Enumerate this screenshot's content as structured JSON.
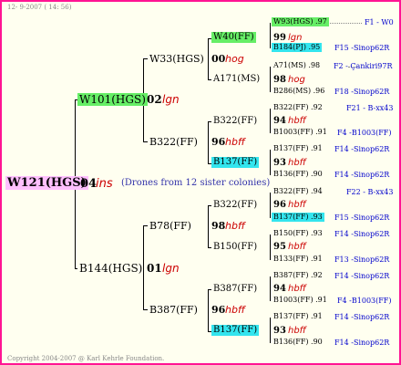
{
  "header_date": "12- 9-2007 ( 14: 56)",
  "footer": "Copyright 2004-2007 @ Karl Kehrle Foundation.",
  "colors": {
    "frame": "#ff1493",
    "green": "#66ee66",
    "cyan": "#33e5ee",
    "pink": "#ffc0ff",
    "style": "#cc0000",
    "blue": "#0000cc"
  },
  "drones_note": "(Drones from 12 sister colonies)",
  "root": {
    "name": "W121(HGS)",
    "year": "04",
    "style": "ins"
  },
  "g1": [
    {
      "name": "W101(HGS)",
      "year": "02",
      "style": "lgn"
    },
    {
      "name": "B144(HGS)",
      "year": "01",
      "style": "lgn"
    }
  ],
  "g2": [
    {
      "name": "W33(HGS)",
      "year": "00",
      "style": "hog"
    },
    {
      "name": "B322(FF)",
      "year": "96",
      "style": "hbff"
    },
    {
      "name": "B78(FF)",
      "year": "98",
      "style": "hbff"
    },
    {
      "name": "B387(FF)",
      "year": "96",
      "style": "hbff"
    }
  ],
  "g3": [
    {
      "name": "W40(FF)",
      "year": "99",
      "style": "lgn"
    },
    {
      "name": "A171(MS)",
      "year": "98",
      "style": "hog"
    },
    {
      "name": "B322(FF)",
      "year": "94",
      "style": "hbff"
    },
    {
      "name": "B137(FF)",
      "year": "93",
      "style": "hbff"
    },
    {
      "name": "B322(FF)",
      "year": "96",
      "style": "hbff"
    },
    {
      "name": "B150(FF)",
      "year": "95",
      "style": "hbff"
    },
    {
      "name": "B387(FF)",
      "year": "94",
      "style": "hbff"
    },
    {
      "name": "B137(FF)",
      "year": "93",
      "style": "hbff"
    }
  ],
  "g4": [
    {
      "name": "W93(HGS)",
      "year": ".97",
      "origin": "F1 - W0"
    },
    {
      "name": "B184(PJ)",
      "year": ".95",
      "origin": "F15 -Sinop62R"
    },
    {
      "name": "A71(MS)",
      "year": ".98",
      "origin": "F2 - Çankiri97R"
    },
    {
      "name": "B286(MS)",
      "year": ".96",
      "origin": "F18 -Sinop62R"
    },
    {
      "name": "B322(FF)",
      "year": ".92",
      "origin": "F21 - B-xx43"
    },
    {
      "name": "B1003(FF)",
      "year": ".91",
      "origin": "F4 -B1003(FF)"
    },
    {
      "name": "B137(FF)",
      "year": ".91",
      "origin": "F14 -Sinop62R"
    },
    {
      "name": "B136(FF)",
      "year": ".90",
      "origin": "F14 -Sinop62R"
    },
    {
      "name": "B322(FF)",
      "year": ".94",
      "origin": "F22 - B-xx43"
    },
    {
      "name": "B137(FF)",
      "year": ".93",
      "origin": "F15 -Sinop62R"
    },
    {
      "name": "B150(FF)",
      "year": ".93",
      "origin": "F14 -Sinop62R"
    },
    {
      "name": "B133(FF)",
      "year": ".91",
      "origin": "F13 -Sinop62R"
    },
    {
      "name": "B387(FF)",
      "year": ".92",
      "origin": "F14 -Sinop62R"
    },
    {
      "name": "B1003(FF)",
      "year": ".91",
      "origin": "F4 -B1003(FF)"
    },
    {
      "name": "B137(FF)",
      "year": ".91",
      "origin": "F14 -Sinop62R"
    },
    {
      "name": "B136(FF)",
      "year": ".90",
      "origin": "F14 -Sinop62R"
    }
  ]
}
